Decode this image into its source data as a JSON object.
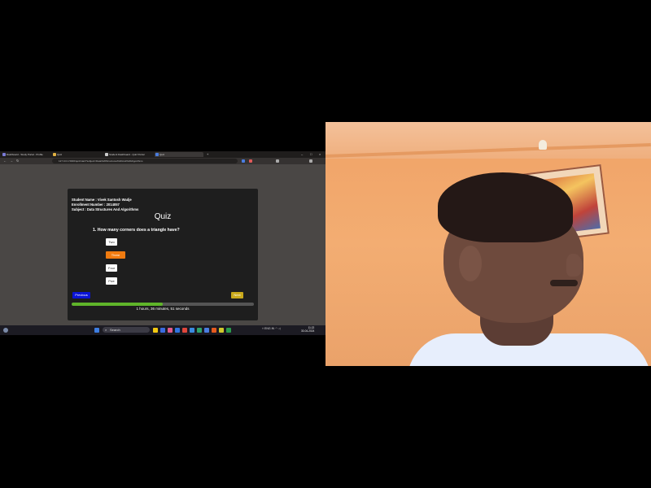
{
  "browser": {
    "tabs": [
      {
        "label": "Dashboard - Study Portal - Profile",
        "color": "#7a7ad6"
      },
      {
        "label": "Quiz",
        "color": "#e0b042"
      },
      {
        "label": "Student Dashboard - Quiz Portal",
        "color": "#cccccc"
      },
      {
        "label": "Quiz",
        "color": "#4a7de0",
        "active": true
      }
    ],
    "new_tab": "+",
    "window_controls": [
      "–",
      "□",
      "×"
    ],
    "url": "127.0.0.1:5000/quiz/start?subject=Data%20Structures%20And%20Algorithms",
    "extension_colors": [
      "#4a7de0",
      "#e05a5a",
      "#aaaaaa",
      "#aaaaaa"
    ]
  },
  "quiz": {
    "student_name": "Student Name : Vivek Santosh Wadje",
    "enrollment": "Enrollment Number : 2014057",
    "subject": "Subject : Data Structures And Algorithms",
    "title": "Quiz",
    "question": "1. How many corners does a triangle have?",
    "options": [
      {
        "label": "Two",
        "selected": false
      },
      {
        "label": "Three",
        "selected": true
      },
      {
        "label": "Four",
        "selected": false
      },
      {
        "label": "Five",
        "selected": false
      }
    ],
    "previous_label": "Previous",
    "next_label": "Next",
    "progress_percent": 50,
    "progress_color": "#5fb52a",
    "timer": "1 hours, 36 minutes, 51 seconds"
  },
  "taskbar": {
    "search_placeholder": "Search",
    "app_colors": [
      "#f2c811",
      "#3b6be0",
      "#e35a8a",
      "#2f74e0",
      "#e0463b",
      "#3a8ae0",
      "#2ea36b",
      "#4a7de0",
      "#e55a1e",
      "#d0c82c",
      "#2a9d4d"
    ],
    "tray_text": "ENG IN",
    "time": "11:22",
    "date": "30-04-2024"
  }
}
